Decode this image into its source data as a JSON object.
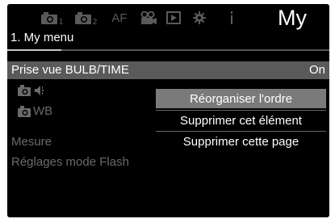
{
  "tabs": [
    {
      "name": "shooting-1",
      "sub": "1"
    },
    {
      "name": "shooting-2",
      "sub": "2"
    },
    {
      "label": "AF"
    },
    {
      "name": "video"
    },
    {
      "name": "playback"
    },
    {
      "name": "settings"
    },
    {
      "name": "info"
    },
    {
      "label": "My"
    }
  ],
  "header": {
    "title": "1. My menu"
  },
  "rows": [
    {
      "label": "Prise vue BULB/TIME",
      "value": "On"
    },
    {
      "label": ""
    },
    {
      "label": "WB"
    },
    {
      "label": "Mesure"
    },
    {
      "label": "Réglages mode Flash"
    }
  ],
  "popup": {
    "items": [
      "Réorganiser l'ordre",
      "Supprimer cet élément",
      "Supprimer cette page"
    ]
  },
  "colors": {
    "selected": "#5a5a5a",
    "highlight": "#7a7a7a",
    "dim": "#6a6a6a"
  }
}
